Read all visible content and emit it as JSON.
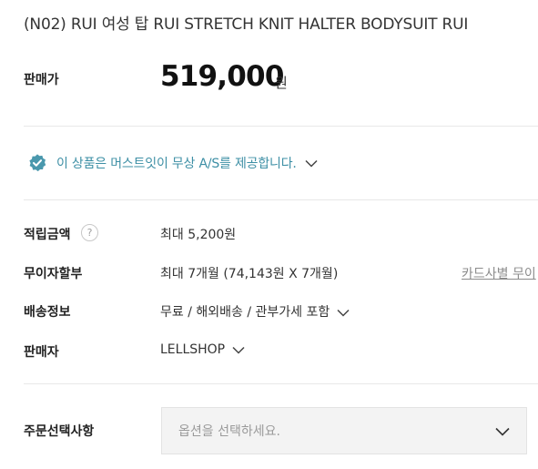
{
  "product": {
    "title": "(N02) RUI 여성 탑 RUI STRETCH KNIT HALTER BODYSUIT RUI"
  },
  "price": {
    "label": "판매가",
    "value": "519,000",
    "unit": "원"
  },
  "as_notice": {
    "text": "이 상품은 머스트잇이 무상 A/S를 제공합니다.",
    "icon": "verified-badge-icon",
    "color": "#3d8fa5"
  },
  "points": {
    "label": "적립금액",
    "help_icon": "?",
    "value": "최대 5,200원"
  },
  "installment": {
    "label": "무이자할부",
    "value": "최대 7개월 (74,143원 X 7개월)",
    "card_link": "카드사별 무이"
  },
  "shipping": {
    "label": "배송정보",
    "value": "무료 / 해외배송 / 관부가세 포함"
  },
  "seller": {
    "label": "판매자",
    "value": "LELLSHOP"
  },
  "options": {
    "label": "주문선택사항",
    "placeholder": "옵션을 선택하세요."
  }
}
